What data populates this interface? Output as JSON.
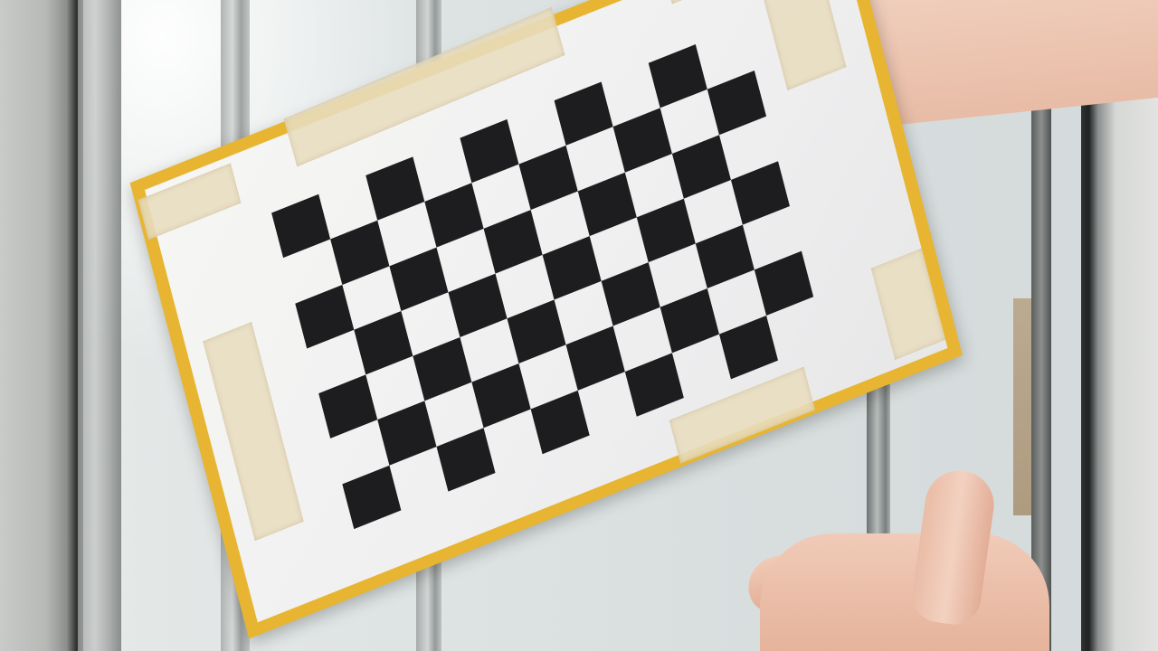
{
  "scene": {
    "subject_icons": [
      "checkerboard-pattern",
      "hand-icon"
    ],
    "colors": {
      "card": "#e7b531",
      "paper": "#f2f2f1",
      "checker_dark": "#1d1d1f",
      "tape": "#e8ddbf",
      "skin": "#f0cbb8",
      "glass": "#dfe4e4"
    },
    "checkerboard": {
      "columns": 10,
      "rows": 7
    }
  }
}
